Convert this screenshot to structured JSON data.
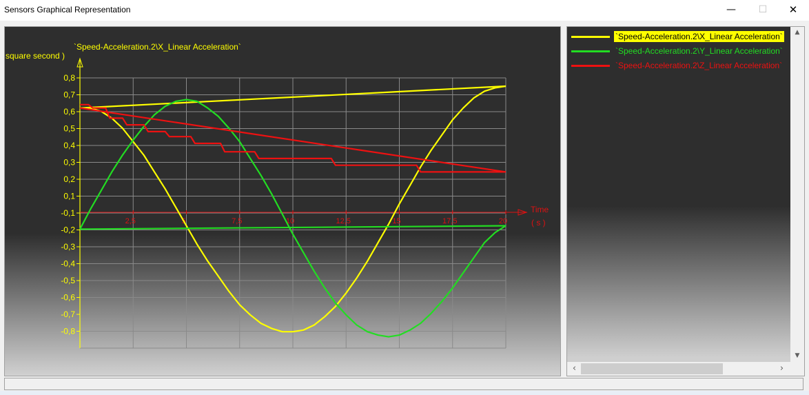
{
  "window": {
    "title": "Sensors Graphical Representation",
    "minimize_icon": "minimize-icon",
    "maximize_icon": "maximize-icon",
    "close_icon": "close-icon"
  },
  "chart_data": {
    "type": "line",
    "title": "`Speed-Acceleration.2\\X_Linear Acceleration`",
    "ylabel": "square second )",
    "xlabel": "Time",
    "xunit": "( s )",
    "ylim": [
      -0.8,
      0.8
    ],
    "xlim": [
      0,
      10
    ],
    "grid": true,
    "y_ticks": [
      "0,8",
      "0,7",
      "0,6",
      "0,5",
      "0,4",
      "0,3",
      "0,2",
      "0,1",
      "-0,1",
      "-0,2",
      "-0,3",
      "-0,4",
      "-0,5",
      "-0,6",
      "-0,7",
      "-0,8"
    ],
    "x_ticks": [
      "2,5",
      "5",
      "7,5",
      "10",
      "12,5",
      "15",
      "17,5",
      "20"
    ],
    "series": [
      {
        "name": "`Speed-Acceleration.2\\X_Linear Acceleration`",
        "color": "#ffff00",
        "x": [
          0,
          0.25,
          0.5,
          0.75,
          1,
          1.25,
          1.5,
          1.75,
          2,
          2.25,
          2.5,
          2.75,
          3,
          3.25,
          3.5,
          3.75,
          4,
          4.25,
          4.5,
          4.75,
          5,
          5.25,
          5.5,
          5.75,
          6,
          6.25,
          6.5,
          6.75,
          7,
          7.25,
          7.5,
          7.75,
          8,
          8.25,
          8.5,
          8.75,
          9,
          9.25,
          9.5,
          9.75,
          10
        ],
        "values": [
          0.62,
          0.62,
          0.6,
          0.56,
          0.5,
          0.42,
          0.34,
          0.24,
          0.14,
          0.03,
          -0.08,
          -0.19,
          -0.29,
          -0.38,
          -0.47,
          -0.55,
          -0.61,
          -0.66,
          -0.69,
          -0.71,
          -0.71,
          -0.7,
          -0.67,
          -0.62,
          -0.56,
          -0.48,
          -0.39,
          -0.29,
          -0.18,
          -0.07,
          0.05,
          0.16,
          0.27,
          0.37,
          0.46,
          0.55,
          0.62,
          0.68,
          0.72,
          0.74,
          0.75
        ],
        "closing_line": {
          "x": [
            0,
            10
          ],
          "values": [
            0.62,
            0.75
          ]
        }
      },
      {
        "name": "`Speed-Acceleration.2\\Y_Linear Acceleration`",
        "color": "#22dd22",
        "x": [
          0,
          0.25,
          0.5,
          0.75,
          1,
          1.25,
          1.5,
          1.75,
          2,
          2.25,
          2.5,
          2.75,
          3,
          3.25,
          3.5,
          3.75,
          4,
          4.25,
          4.5,
          4.75,
          5,
          5.25,
          5.5,
          5.75,
          6,
          6.25,
          6.5,
          6.75,
          7,
          7.25,
          7.5,
          7.75,
          8,
          8.25,
          8.5,
          8.75,
          9,
          9.25,
          9.5,
          9.75,
          10
        ],
        "values": [
          -0.1,
          0.02,
          0.13,
          0.24,
          0.34,
          0.43,
          0.51,
          0.58,
          0.63,
          0.66,
          0.67,
          0.66,
          0.62,
          0.57,
          0.5,
          0.42,
          0.32,
          0.22,
          0.11,
          -0.01,
          -0.13,
          -0.24,
          -0.35,
          -0.45,
          -0.54,
          -0.61,
          -0.67,
          -0.71,
          -0.73,
          -0.74,
          -0.73,
          -0.7,
          -0.66,
          -0.6,
          -0.53,
          -0.45,
          -0.36,
          -0.27,
          -0.18,
          -0.12,
          -0.08
        ],
        "closing_line": {
          "x": [
            0,
            10
          ],
          "values": [
            -0.1,
            -0.08
          ]
        }
      },
      {
        "name": "`Speed-Acceleration.2\\Z_Linear Acceleration`",
        "color": "#ee1111",
        "step_x": [
          0,
          0.3,
          0.7,
          1.1,
          1.6,
          2.1,
          2.7,
          3.4,
          4.2,
          5.0,
          6.0,
          7.0,
          8.0,
          10
        ],
        "values": [
          0.64,
          0.62,
          0.56,
          0.52,
          0.48,
          0.45,
          0.41,
          0.36,
          0.32,
          0.32,
          0.28,
          0.28,
          0.24,
          0.24
        ],
        "closing_line": {
          "x": [
            0,
            10
          ],
          "values": [
            0.62,
            0.24
          ]
        }
      }
    ]
  },
  "legend": {
    "items": [
      {
        "label": "`Speed-Acceleration.2\\X_Linear Acceleration`",
        "color": "#ffff00",
        "text_color": "#000000",
        "highlight": "#ffff00"
      },
      {
        "label": "`Speed-Acceleration.2\\Y_Linear Acceleration`",
        "color": "#22dd22",
        "text_color": "#22dd22",
        "highlight": ""
      },
      {
        "label": "`Speed-Acceleration.2\\Z_Linear Acceleration`",
        "color": "#ee1111",
        "text_color": "#ee1111",
        "highlight": ""
      }
    ],
    "scroll_up_icon": "up-arrow-icon",
    "scroll_down_icon": "down-arrow-icon",
    "scroll_left_icon": "left-arrow-icon",
    "scroll_right_icon": "right-arrow-icon"
  },
  "status": {
    "text": ""
  }
}
